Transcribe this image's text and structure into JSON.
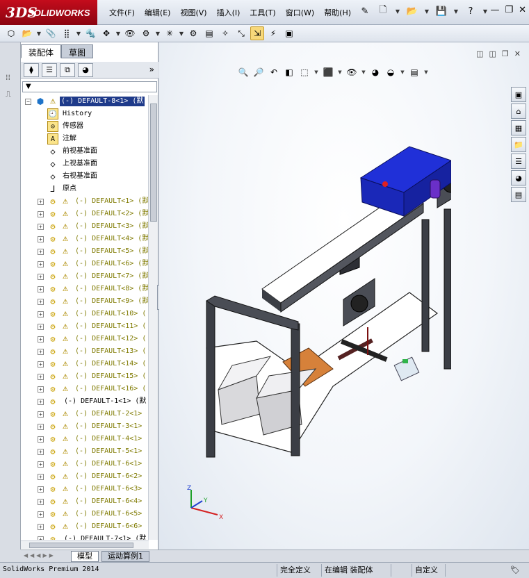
{
  "app": {
    "brand_mark": "3DS",
    "brand_name": "SOLIDWORKS"
  },
  "menu": [
    "文件(F)",
    "编辑(E)",
    "视图(V)",
    "插入(I)",
    "工具(T)",
    "窗口(W)",
    "帮助(H)"
  ],
  "window_controls": [
    "minimize",
    "restore",
    "close"
  ],
  "panel_tabs": [
    "装配体",
    "草图"
  ],
  "tree": {
    "root": "(-) DEFAULT-8<1> (默",
    "fixed_items": [
      "History",
      "传感器",
      "注解",
      "前视基准面",
      "上视基准面",
      "右视基准面",
      "原点"
    ],
    "components": [
      "(-) DEFAULT<1> (默",
      "(-) DEFAULT<2> (默",
      "(-) DEFAULT<3> (默",
      "(-) DEFAULT<4> (默",
      "(-) DEFAULT<5> (默",
      "(-) DEFAULT<6> (默",
      "(-) DEFAULT<7> (默",
      "(-) DEFAULT<8> (默",
      "(-) DEFAULT<9> (默",
      "(-) DEFAULT<10> (",
      "(-) DEFAULT<11> (",
      "(-) DEFAULT<12> (",
      "(-) DEFAULT<13> (",
      "(-) DEFAULT<14> (",
      "(-) DEFAULT<15> (",
      "(-) DEFAULT<16> (",
      "(-) DEFAULT-1<1> (默",
      "(-) DEFAULT-2<1>",
      "(-) DEFAULT-3<1>",
      "(-) DEFAULT-4<1>",
      "(-) DEFAULT-5<1>",
      "(-) DEFAULT-6<1>",
      "(-) DEFAULT-6<2>",
      "(-) DEFAULT-6<3>",
      "(-) DEFAULT-6<4>",
      "(-) DEFAULT-6<5>",
      "(-) DEFAULT-6<6>",
      "(-) DEFAULT-7<1> (默"
    ]
  },
  "triad": {
    "x": "X",
    "y": "Y",
    "z": "Z"
  },
  "bottom_tabs": [
    "模型",
    "运动算例1"
  ],
  "status": {
    "product": "SolidWorks Premium 2014",
    "definition": "完全定义",
    "mode": "在编辑 装配体",
    "units": "自定义"
  },
  "colors": {
    "brand_red": "#b00818",
    "selection": "#1e3a8a",
    "warning": "#e5b700",
    "motor_blue": "#1f2fd0",
    "frame_dark": "#3b3e45"
  }
}
